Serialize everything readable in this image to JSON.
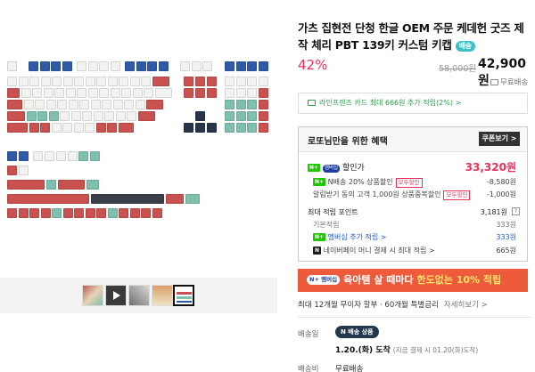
{
  "product": {
    "title": "가츠 집현전 단청 한글 OEM 주문 케데헌 굿즈 제작 체리 PBT 139키 커스텀 키캡",
    "title_badge": "배송"
  },
  "price": {
    "discount": "42%",
    "original": "58,000원",
    "current": "42,900원",
    "shipping": "무료배송"
  },
  "card_benefit": "라인프렌즈 카드 최대 666원 추가 적립(2%) >",
  "benefit_box": {
    "title": "로또님만을 위한 혜택",
    "coupon_button": "쿠폰보기 >",
    "discount_label": "할인가",
    "discount_price": "33,320원",
    "npay_label": "N배송 20% 상품할인",
    "npay_tag": "모두할인",
    "npay_value": "-8,580원",
    "alarm_label": "알림받기 동의 고객 1,000원 상품중복할인",
    "alarm_tag": "모두할인",
    "alarm_value": "-1,000원",
    "points_label": "최대 적립 포인트",
    "points_value": "3,181원",
    "points_help": "?",
    "base_label": "기본적립",
    "base_value": "333원",
    "membership_label": "멤버십 추가 적립 >",
    "membership_value": "333원",
    "naverpay_label": "네이버페이 머니 결제 시 최대 적립 >",
    "naverpay_value": "665원"
  },
  "promo": {
    "badge": "N+ 멤버십",
    "text_main": "육아템 살 때마다 ",
    "text_highlight": "한도없는 10% 적립"
  },
  "installment": {
    "text": "최대 12개월 무이자 할부 · 60개월 특별금리",
    "more": "자세히보기 >"
  },
  "delivery": {
    "label": "배송일",
    "pill": "N 배송 상품",
    "date": "1.20.(화) 도착",
    "date_note": "(지금 결제 시 01.20(화)도착)",
    "fee_label": "배송비",
    "fee_value": "무료배송"
  },
  "thumbnails": [
    "thumb-1",
    "thumb-video",
    "thumb-3",
    "thumb-4",
    "thumb-5"
  ],
  "colors": {
    "accent_red": "#e8325a",
    "promo_orange": "#ee5b3c",
    "card_green": "#2a9d4b",
    "keycap_red": "#c9514f",
    "keycap_blue": "#2f5aa8",
    "keycap_mint": "#7fbfad",
    "keycap_navy": "#273449"
  }
}
